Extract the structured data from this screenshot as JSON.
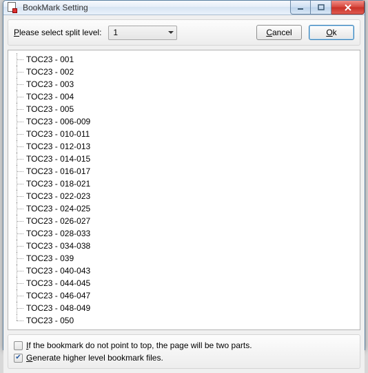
{
  "window": {
    "title": "BookMark Setting"
  },
  "top": {
    "label": "Please select split level:",
    "combo_value": "1",
    "cancel": "Cancel",
    "ok": "Ok"
  },
  "tree": {
    "items": [
      "TOC23 - 001",
      "TOC23 - 002",
      "TOC23 - 003",
      "TOC23 - 004",
      "TOC23 - 005",
      "TOC23 - 006-009",
      "TOC23 - 010-011",
      "TOC23 - 012-013",
      "TOC23 - 014-015",
      "TOC23 - 016-017",
      "TOC23 - 018-021",
      "TOC23 - 022-023",
      "TOC23 - 024-025",
      "TOC23 - 026-027",
      "TOC23 - 028-033",
      "TOC23 - 034-038",
      "TOC23 - 039",
      "TOC23 - 040-043",
      "TOC23 - 044-045",
      "TOC23 - 046-047",
      "TOC23 - 048-049",
      "TOC23 - 050"
    ]
  },
  "bottom": {
    "opt1": {
      "checked": false,
      "label": "If the bookmark do not point to top,  the page will be two parts."
    },
    "opt2": {
      "checked": true,
      "label": "Generate higher level bookmark files."
    }
  }
}
